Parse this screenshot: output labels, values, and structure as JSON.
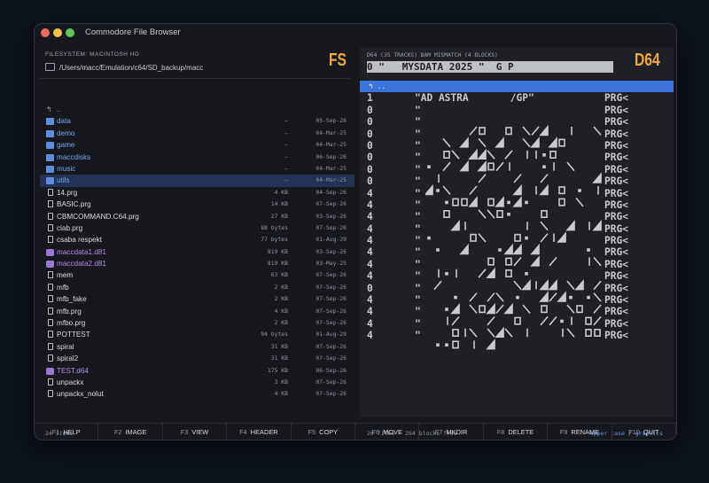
{
  "window": {
    "title": "Commodore File Browser"
  },
  "left": {
    "heading": "FILESYSTEM: MACINTOSH HD",
    "path": "/Users/macc/Emulation/c64/SD_backup/macc",
    "badge": "FS",
    "items": [
      {
        "type": "up",
        "name": "..",
        "size": "",
        "date": ""
      },
      {
        "type": "dir",
        "name": "data",
        "size": "—",
        "date": "05-Sep-26"
      },
      {
        "type": "dir",
        "name": "demo",
        "size": "—",
        "date": "04-Mar-25"
      },
      {
        "type": "dir",
        "name": "game",
        "size": "—",
        "date": "04-Mar-25"
      },
      {
        "type": "dir",
        "name": "maccdisks",
        "size": "—",
        "date": "06-Sep-26"
      },
      {
        "type": "dir",
        "name": "music",
        "size": "—",
        "date": "04-Mar-25"
      },
      {
        "type": "dir",
        "name": "utils",
        "size": "—",
        "date": "04-Mar-25",
        "selected": true
      },
      {
        "type": "file",
        "name": "14.prg",
        "size": "4 KB",
        "date": "04-Sep-26"
      },
      {
        "type": "file",
        "name": "BASIC.prg",
        "size": "14 KB",
        "date": "07-Sep-26"
      },
      {
        "type": "file",
        "name": "CBMCOMMAND.C64.prg",
        "size": "27 KB",
        "date": "03-Sep-26"
      },
      {
        "type": "file",
        "name": "ciab.prg",
        "size": "88 bytes",
        "date": "07-Sep-26"
      },
      {
        "type": "file",
        "name": "csaba respekt",
        "size": "77 bytes",
        "date": "01-Aug-29"
      },
      {
        "type": "disk",
        "name": "maccdata1.d81",
        "size": "819 KB",
        "date": "03-Sep-26"
      },
      {
        "type": "disk",
        "name": "maccdata2.d81",
        "size": "819 KB",
        "date": "03-May-25"
      },
      {
        "type": "file",
        "name": "mem",
        "size": "63 KB",
        "date": "07-Sep-26"
      },
      {
        "type": "file",
        "name": "mfb",
        "size": "2 KB",
        "date": "07-Sep-26"
      },
      {
        "type": "file",
        "name": "mfb_fake",
        "size": "2 KB",
        "date": "07-Sep-26"
      },
      {
        "type": "file",
        "name": "mfb.prg",
        "size": "4 KB",
        "date": "07-Sep-26"
      },
      {
        "type": "file",
        "name": "mfbo.prg",
        "size": "2 KB",
        "date": "07-Sep-26"
      },
      {
        "type": "file",
        "name": "POTTEST",
        "size": "94 bytes",
        "date": "01-Aug-29"
      },
      {
        "type": "file",
        "name": "spiral",
        "size": "31 KB",
        "date": "07-Sep-26"
      },
      {
        "type": "file",
        "name": "spiral2",
        "size": "31 KB",
        "date": "07-Sep-26"
      },
      {
        "type": "disk",
        "name": "TEST.d64",
        "size": "175 KB",
        "date": "06-Sep-26"
      },
      {
        "type": "file",
        "name": "unpackx",
        "size": "3 KB",
        "date": "07-Sep-26"
      },
      {
        "type": "file",
        "name": "unpackx_nolut",
        "size": "4 KB",
        "date": "07-Sep-26"
      }
    ],
    "count": "24 items"
  },
  "right": {
    "heading": "D64 (35 TRACKS)  BAM MISMATCH (4 BLOCKS)",
    "badge": "D64",
    "disk_header": "0 \"   MYSDATA 2025 \"  G P",
    "up_row": "↰ ..",
    "entries": [
      {
        "blocks": "1",
        "name": "\"AD ASTRA       /GP\"",
        "type": "PRG<"
      },
      {
        "blocks": "0",
        "name": "\"",
        "type": "PRG<"
      },
      {
        "blocks": "0",
        "name": "\"",
        "type": "PRG<"
      },
      {
        "blocks": "0",
        "name": "\"",
        "type": "PRG<"
      },
      {
        "blocks": "0",
        "name": "\"",
        "type": "PRG<"
      },
      {
        "blocks": "0",
        "name": "\"",
        "type": "PRG<"
      },
      {
        "blocks": "0",
        "name": "\"",
        "type": "PRG<"
      },
      {
        "blocks": "0",
        "name": "\"",
        "type": "PRG<"
      },
      {
        "blocks": "4",
        "name": "\"",
        "type": "PRG<"
      },
      {
        "blocks": "4",
        "name": "\"",
        "type": "PRG<"
      },
      {
        "blocks": "4",
        "name": "\"",
        "type": "PRG<"
      },
      {
        "blocks": "4",
        "name": "\"",
        "type": "PRG<"
      },
      {
        "blocks": "4",
        "name": "\"",
        "type": "PRG<"
      },
      {
        "blocks": "4",
        "name": "\"",
        "type": "PRG<"
      },
      {
        "blocks": "4",
        "name": "\"",
        "type": "PRG<"
      },
      {
        "blocks": "4",
        "name": "\"",
        "type": "PRG<"
      },
      {
        "blocks": "0",
        "name": "\"",
        "type": "PRG<"
      },
      {
        "blocks": "4",
        "name": "\"",
        "type": "PRG<"
      },
      {
        "blocks": "4",
        "name": "\"",
        "type": "PRG<"
      },
      {
        "blocks": "4",
        "name": "\"",
        "type": "PRG<"
      },
      {
        "blocks": "4",
        "name": "\"",
        "type": "PRG<"
      }
    ],
    "footer": "20 files · 264 blocks free",
    "charset_link": "Upper case",
    "charset_sep": " / ",
    "charset_mode": "graphics"
  },
  "fkeys": [
    {
      "num": "F1",
      "label": "HELP"
    },
    {
      "num": "F2",
      "label": "IMAGE"
    },
    {
      "num": "F3",
      "label": "VIEW"
    },
    {
      "num": "F4",
      "label": "HEADER"
    },
    {
      "num": "F5",
      "label": "COPY"
    },
    {
      "num": "F6",
      "label": "MOVE"
    },
    {
      "num": "F7",
      "label": "MKDIR"
    },
    {
      "num": "F8",
      "label": "DELETE"
    },
    {
      "num": "F9",
      "label": "RENAME"
    },
    {
      "num": "F10",
      "label": "QUIT"
    }
  ],
  "colors": {
    "accent": "#f2a93b",
    "selection": "#3d74dc",
    "dir": "#74a6f0",
    "disk": "#b48ae8"
  }
}
